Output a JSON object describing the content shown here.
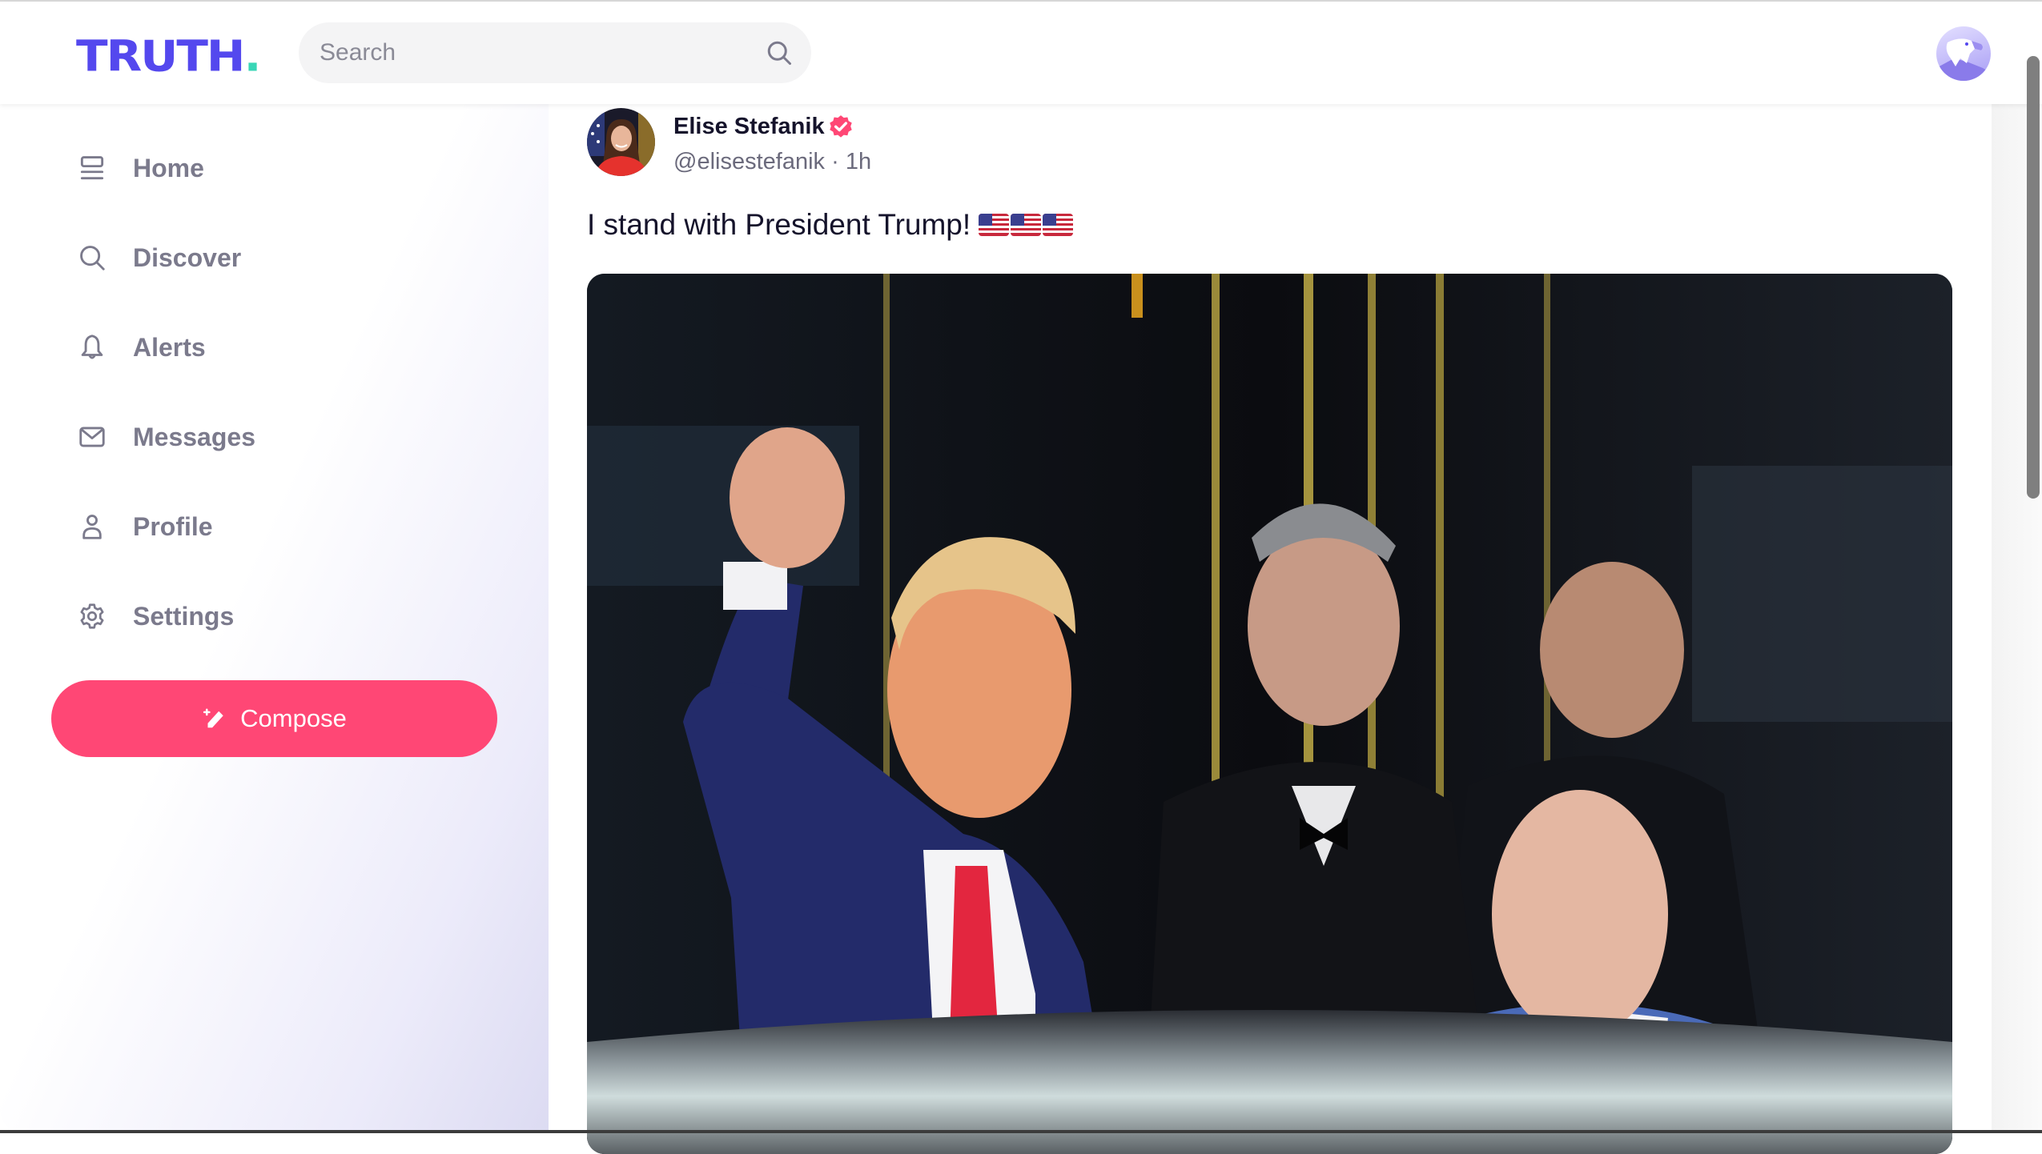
{
  "header": {
    "logo_text": "TRUTH",
    "logo_dot": ".",
    "search_placeholder": "Search",
    "search_value": ""
  },
  "sidebar": {
    "items": [
      {
        "label": "Home",
        "icon": "home-icon"
      },
      {
        "label": "Discover",
        "icon": "search-icon"
      },
      {
        "label": "Alerts",
        "icon": "bell-icon"
      },
      {
        "label": "Messages",
        "icon": "envelope-icon"
      },
      {
        "label": "Profile",
        "icon": "user-icon"
      },
      {
        "label": "Settings",
        "icon": "gear-icon"
      }
    ],
    "compose_label": "Compose"
  },
  "post": {
    "author_name": "Elise Stefanik",
    "verified": true,
    "handle": "@elisestefanik",
    "separator": "·",
    "timestamp": "1h",
    "text": "I stand with President Trump!",
    "emoji": [
      "us-flag",
      "us-flag",
      "us-flag"
    ],
    "image_description": "Donald Trump raising a fist outside a building entrance, wearing a navy suit and red tie, with men in dark suits behind him"
  },
  "colors": {
    "brand": "#5448ee",
    "brand_dot": "#38d6b6",
    "compose": "#ff4775",
    "nav_text": "#7b7a8c",
    "verified": "#ff4775"
  }
}
